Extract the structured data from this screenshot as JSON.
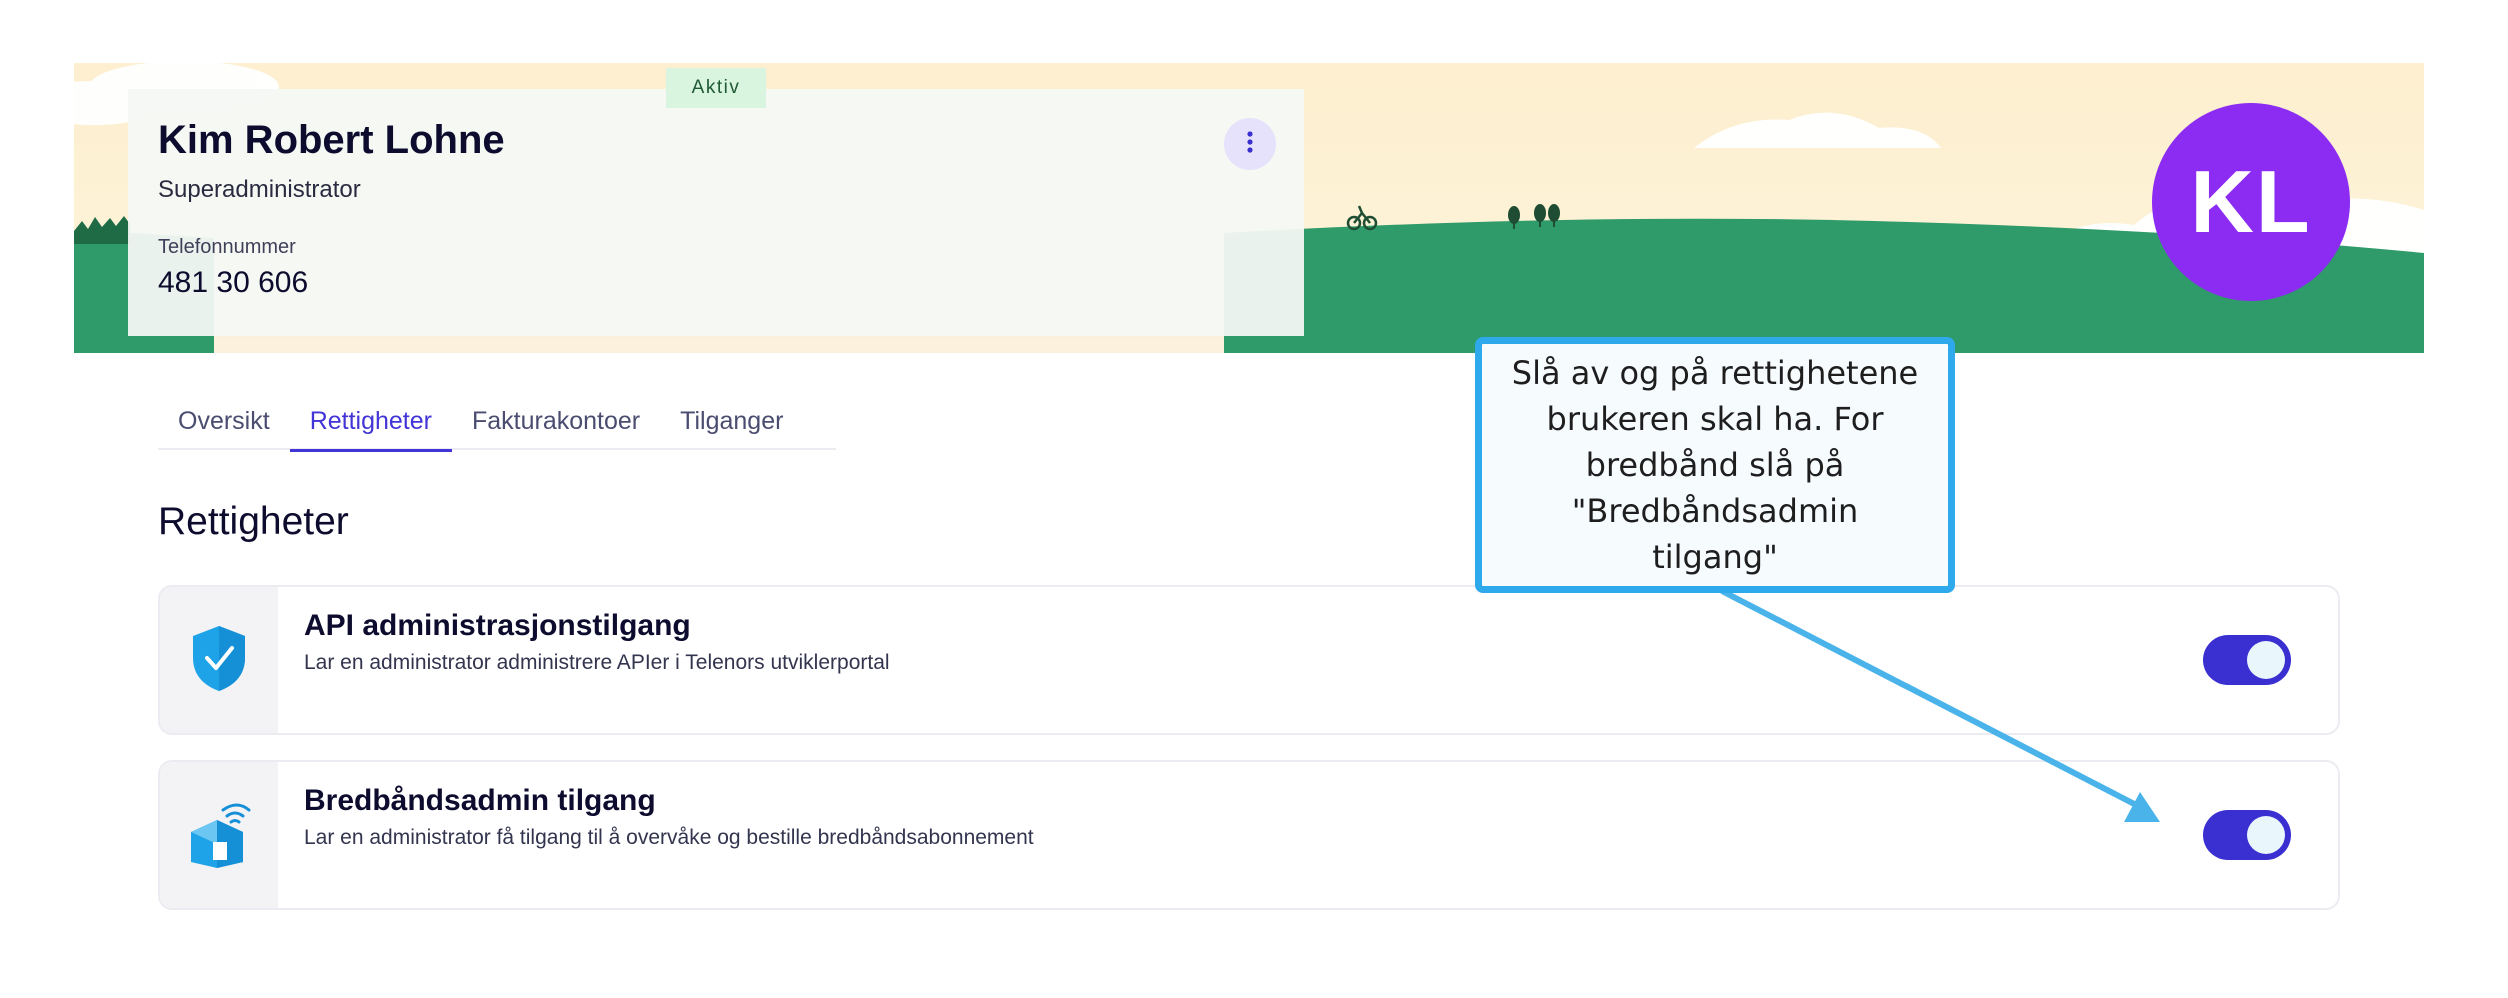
{
  "profile": {
    "name": "Kim Robert Lohne",
    "role": "Superadministrator",
    "phone_label": "Telefonnummer",
    "phone": "481 30 606",
    "status": "Aktiv",
    "avatar_initials": "KL",
    "menu_icon": "kebab-vertical-icon"
  },
  "tabs": [
    {
      "label": "Oversikt",
      "active": false
    },
    {
      "label": "Rettigheter",
      "active": true
    },
    {
      "label": "Fakturakontoer",
      "active": false
    },
    {
      "label": "Tilganger",
      "active": false
    }
  ],
  "section": {
    "heading": "Rettigheter"
  },
  "permissions": [
    {
      "title": "API administrasjonstilgang",
      "description": "Lar en administrator administrere APIer i Telenors utviklerportal",
      "icon": "shield-check-icon",
      "enabled": true
    },
    {
      "title": "Bredbåndsadmin tilgang",
      "description": "Lar en administrator få tilgang til å overvåke og bestille bredbåndsabonnement",
      "icon": "broadband-house-icon",
      "enabled": true
    }
  ],
  "callout": {
    "text": "Slå av og på rettighetene\nbrukeren skal ha. For\nbredbånd slå på\n\"Bredbåndsadmin tilgang\""
  },
  "colors": {
    "accent": "#4234d6",
    "toggle_on": "#3a2fd1",
    "avatar": "#8c2cf2",
    "grass": "#2f9a6a",
    "callout_border": "#2ea9ec",
    "status_badge": "#d9f5df"
  }
}
